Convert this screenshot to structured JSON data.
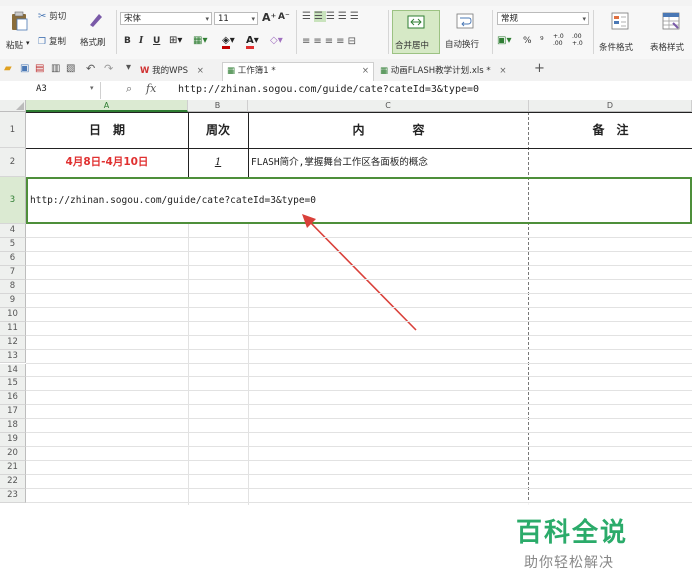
{
  "ribbon": {
    "paste_label": "粘贴",
    "cut_label": "剪切",
    "copy_label": "复制",
    "format_painter_label": "格式刷",
    "font_name": "宋体",
    "font_size": "11",
    "font_grow": "A⁺",
    "font_shrink": "A⁻",
    "bold": "B",
    "italic": "I",
    "underline": "U",
    "merge_center_label": "合并居中",
    "wrap_text_label": "自动换行",
    "number_format": "常规",
    "percent": "%",
    "comma": "⁹",
    "dec_inc": "+.0\n.00",
    "dec_dec": ".00\n+.0",
    "cond_format_label": "条件格式",
    "table_style_label": "表格样式"
  },
  "doc_tabs": {
    "wps_label": "我的WPS",
    "workbook1_label": "工作簿1 *",
    "workbook2_label": "动画FLASH教学计划.xls *"
  },
  "formula_bar": {
    "cell_ref": "A3",
    "fx": "fx",
    "content": "http://zhinan.sogou.com/guide/cate?cateId=3&type=0"
  },
  "columns": [
    "A",
    "B",
    "C",
    "D"
  ],
  "rows": {
    "numbers": [
      "1",
      "2",
      "3",
      "4",
      "5",
      "6",
      "7",
      "8",
      "9",
      "10",
      "11",
      "12",
      "13",
      "14",
      "15",
      "16",
      "17",
      "18",
      "19",
      "20",
      "21",
      "22",
      "23"
    ]
  },
  "table": {
    "header": [
      "日　期",
      "周次",
      "内　　　　容",
      "备　注"
    ],
    "row2": {
      "date": "4月8日-4月10日",
      "week": "1",
      "content": "FLASH简介,掌握舞台工作区各面板的概念",
      "note": ""
    },
    "row3": {
      "url": "http://zhinan.sogou.com/guide/cate?cateId=3&type=0"
    }
  },
  "watermark": {
    "title": "百科全说",
    "subtitle": "助你轻松解决"
  },
  "colors": {
    "accent_green": "#2e7d32",
    "date_red": "#e03030",
    "arrow_red": "#d9403a"
  }
}
